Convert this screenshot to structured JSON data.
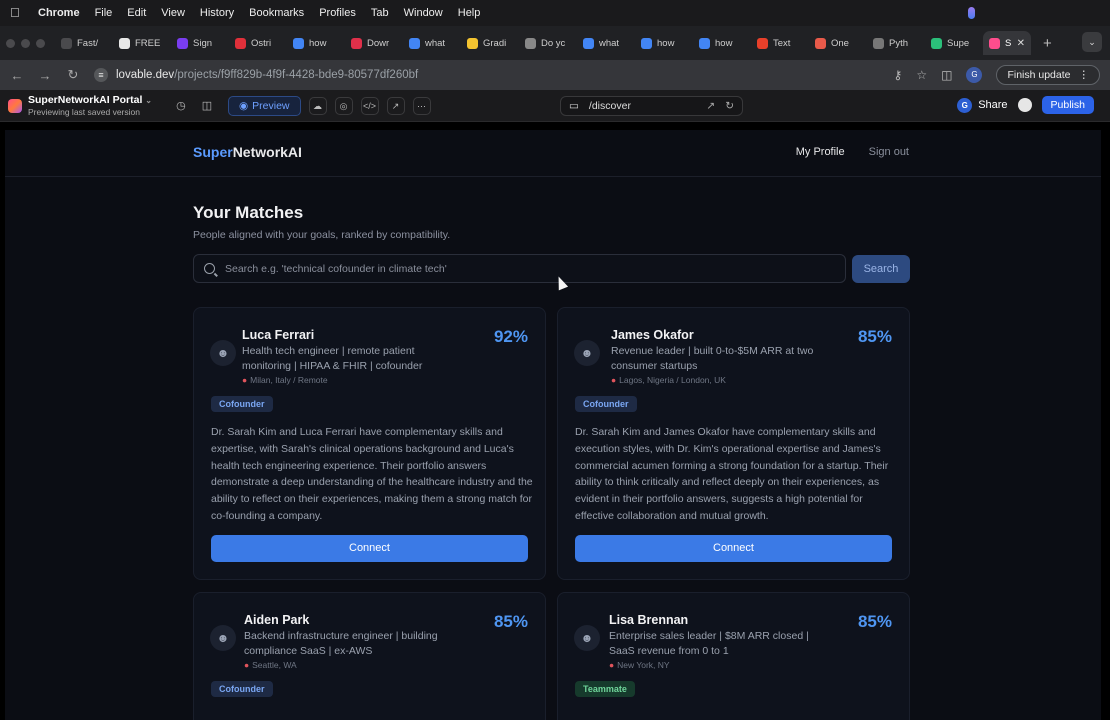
{
  "menubar": {
    "app": "Chrome",
    "items": [
      "File",
      "Edit",
      "View",
      "History",
      "Bookmarks",
      "Profiles",
      "Tab",
      "Window",
      "Help"
    ]
  },
  "tabs": [
    {
      "label": "Fast/",
      "color": "#4a4a4d"
    },
    {
      "label": "FREE",
      "color": "#e8e8e8"
    },
    {
      "label": "Sign",
      "color": "#7a3df0"
    },
    {
      "label": "Ostri",
      "color": "#e0303a"
    },
    {
      "label": "how",
      "color": "#4285f4"
    },
    {
      "label": "Dowr",
      "color": "#e0304a"
    },
    {
      "label": "what",
      "color": "#4285f4"
    },
    {
      "label": "Gradi",
      "color": "#f4c430"
    },
    {
      "label": "Do yc",
      "color": "#888888"
    },
    {
      "label": "what",
      "color": "#4285f4"
    },
    {
      "label": "how",
      "color": "#4285f4"
    },
    {
      "label": "how",
      "color": "#4285f4"
    },
    {
      "label": "Text",
      "color": "#e8402a"
    },
    {
      "label": "One",
      "color": "#e85a4a"
    },
    {
      "label": "Pyth",
      "color": "#777777"
    },
    {
      "label": "Supe",
      "color": "#2bbf7a"
    },
    {
      "label": "S",
      "color": "#ff4d8d",
      "active": true
    }
  ],
  "address": {
    "domain": "lovable.dev",
    "path": "/projects/f9ff829b-4f9f-4428-bde9-80577df260bf",
    "finish_update": "Finish update"
  },
  "lovable": {
    "project_name": "SuperNetworkAI Portal",
    "project_status": "Previewing last saved version",
    "preview_label": "Preview",
    "route": "/discover",
    "share": "Share",
    "publish": "Publish",
    "avatar_letter": "G"
  },
  "site": {
    "logo_part1": "Super",
    "logo_part2": "NetworkAI",
    "nav": {
      "profile": "My Profile",
      "signout": "Sign out"
    },
    "heading": "Your Matches",
    "subheading": "People aligned with your goals, ranked by compatibility.",
    "search_placeholder": "Search e.g. 'technical cofounder in climate tech'",
    "search_button": "Search",
    "connect_label": "Connect"
  },
  "matches": [
    {
      "name": "Luca Ferrari",
      "score": "92%",
      "headline": "Health tech engineer | remote patient monitoring | HIPAA & FHIR | cofounder",
      "location": "Milan, Italy / Remote",
      "badge": "Cofounder",
      "description": "Dr. Sarah Kim and Luca Ferrari have complementary skills and expertise, with Sarah's clinical operations background and Luca's health tech engineering experience. Their portfolio answers demonstrate a deep understanding of the healthcare industry and the ability to reflect on their experiences, making them a strong match for co-founding a company."
    },
    {
      "name": "James Okafor",
      "score": "85%",
      "headline": "Revenue leader | built 0-to-$5M ARR at two consumer startups",
      "location": "Lagos, Nigeria / London, UK",
      "badge": "Cofounder",
      "description": "Dr. Sarah Kim and James Okafor have complementary skills and execution styles, with Dr. Kim's operational expertise and James's commercial acumen forming a strong foundation for a startup. Their ability to think critically and reflect deeply on their experiences, as evident in their portfolio answers, suggests a high potential for effective collaboration and mutual growth."
    },
    {
      "name": "Aiden Park",
      "score": "85%",
      "headline": "Backend infrastructure engineer | building compliance SaaS | ex-AWS",
      "location": "Seattle, WA",
      "badge": "Cofounder",
      "description": ""
    },
    {
      "name": "Lisa Brennan",
      "score": "85%",
      "headline": "Enterprise sales leader | $8M ARR closed | SaaS revenue from 0 to 1",
      "location": "New York, NY",
      "badge": "Teammate",
      "description": ""
    }
  ]
}
